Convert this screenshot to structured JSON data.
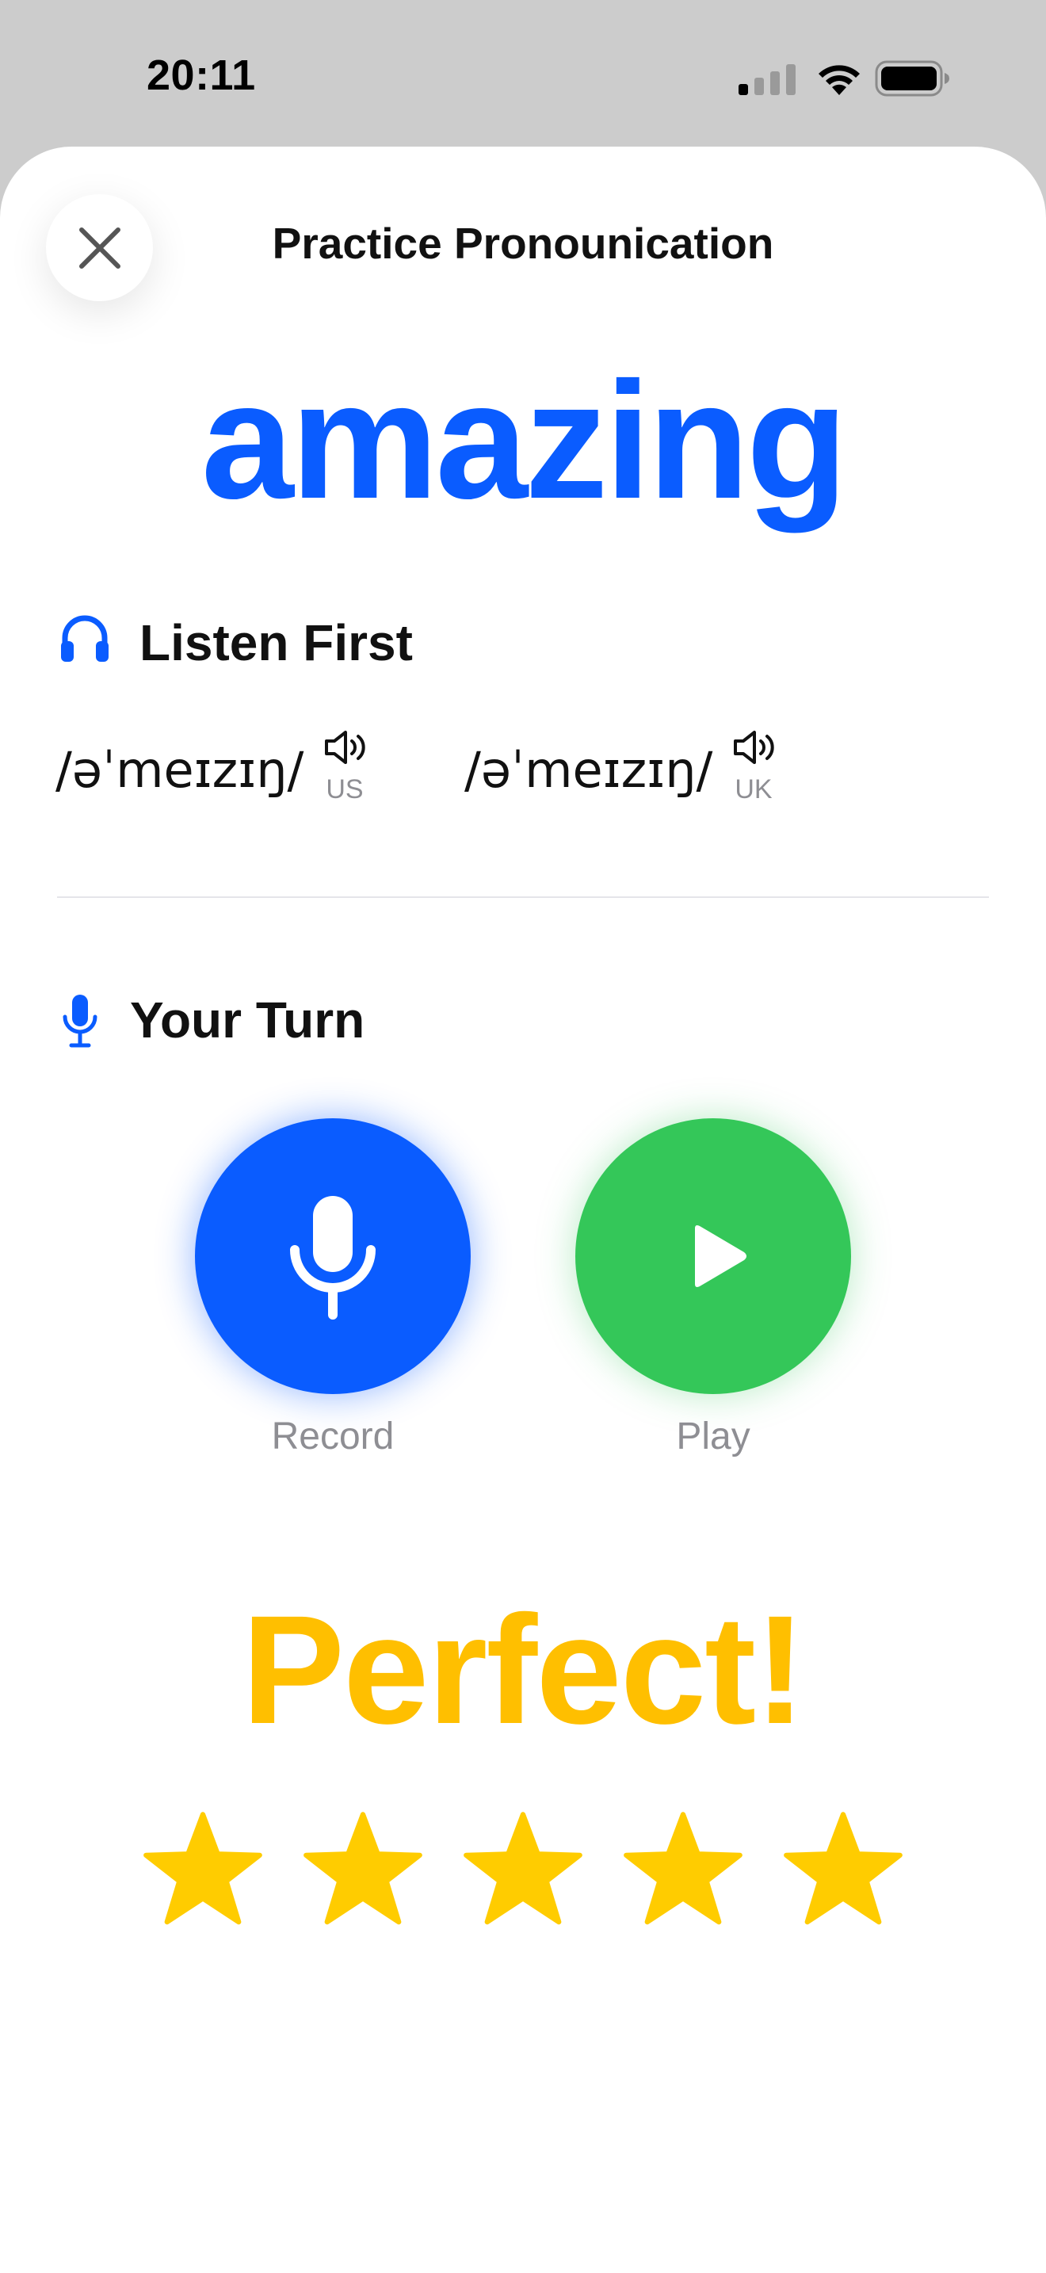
{
  "status_bar": {
    "time": "20:11",
    "icons": [
      "cellular-signal-icon",
      "wifi-icon",
      "battery-icon"
    ]
  },
  "header": {
    "title": "Practice Pronounication",
    "close_icon": "close-icon"
  },
  "word": "amazing",
  "listen": {
    "title": "Listen First",
    "icon": "headphones-icon",
    "pronunciations": [
      {
        "ipa": "/əˈmeɪzɪŋ/",
        "accent": "US",
        "icon": "speaker-icon"
      },
      {
        "ipa": "/əˈmeɪzɪŋ/",
        "accent": "UK",
        "icon": "speaker-icon"
      }
    ]
  },
  "your_turn": {
    "title": "Your Turn",
    "icon": "microphone-icon",
    "record_label": "Record",
    "play_label": "Play"
  },
  "result": {
    "text": "Perfect!",
    "rating": 5,
    "max_rating": 5
  },
  "colors": {
    "accent_blue": "#0a5cff",
    "play_green": "#34c759",
    "result_yellow": "#ffbf00",
    "star_yellow": "#ffcc00"
  }
}
